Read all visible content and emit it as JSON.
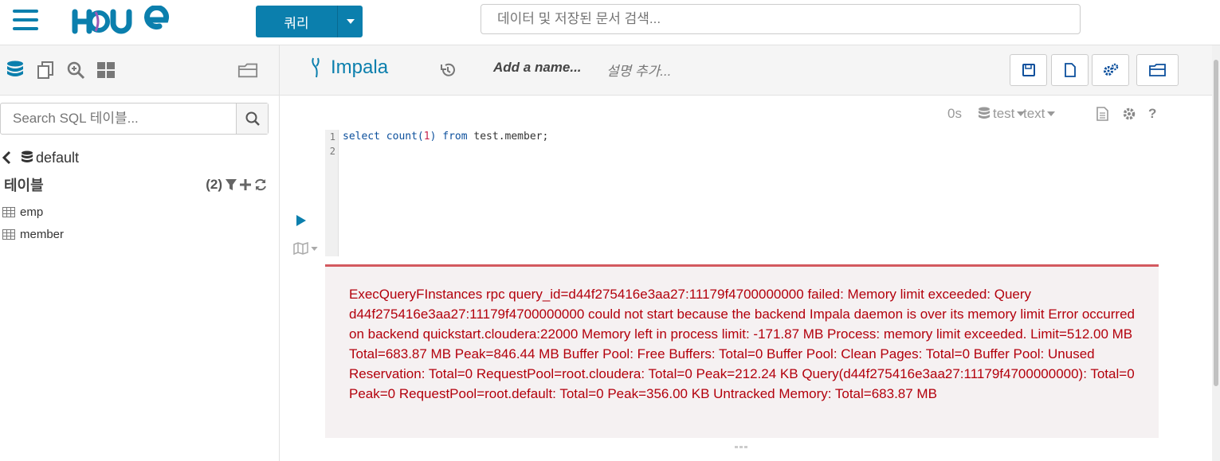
{
  "topbar": {
    "query_button_label": "쿼리",
    "search_placeholder": "데이터 및 저장된 문서 검색..."
  },
  "left_panel": {
    "search_placeholder": "Search SQL 테이블...",
    "database": "default",
    "tables_title": "테이블",
    "tables_count": "(2)",
    "tables": [
      "emp",
      "member"
    ]
  },
  "editor": {
    "engine": "Impala",
    "name_placeholder": "Add a name...",
    "description_placeholder": "설명 추가...",
    "toolbar": {
      "duration": "0s",
      "database": "test",
      "format": "text"
    },
    "line_numbers": [
      "1",
      "2"
    ],
    "code": {
      "kw_select": "select",
      "fn": "count(",
      "arg": "1",
      "close": ")",
      "kw_from": "from",
      "rest": "test.member;"
    },
    "error_message": "ExecQueryFInstances rpc query_id=d44f275416e3aa27:11179f4700000000 failed: Memory limit exceeded: Query d44f275416e3aa27:11179f4700000000 could not start because the backend Impala daemon is over its memory limit Error occurred on backend quickstart.cloudera:22000 Memory left in process limit: -171.87 MB Process: memory limit exceeded. Limit=512.00 MB Total=683.87 MB Peak=846.44 MB Buffer Pool: Free Buffers: Total=0 Buffer Pool: Clean Pages: Total=0 Buffer Pool: Unused Reservation: Total=0 RequestPool=root.cloudera: Total=0 Peak=212.24 KB Query(d44f275416e3aa27:11179f4700000000): Total=0 Peak=0 RequestPool=root.default: Total=0 Peak=356.00 KB Untracked Memory: Total=683.87 MB"
  },
  "colors": {
    "brand": "#0b7fad",
    "error_text": "#b3000c",
    "error_border": "#d3595f",
    "error_bg": "#f5f1f2"
  }
}
